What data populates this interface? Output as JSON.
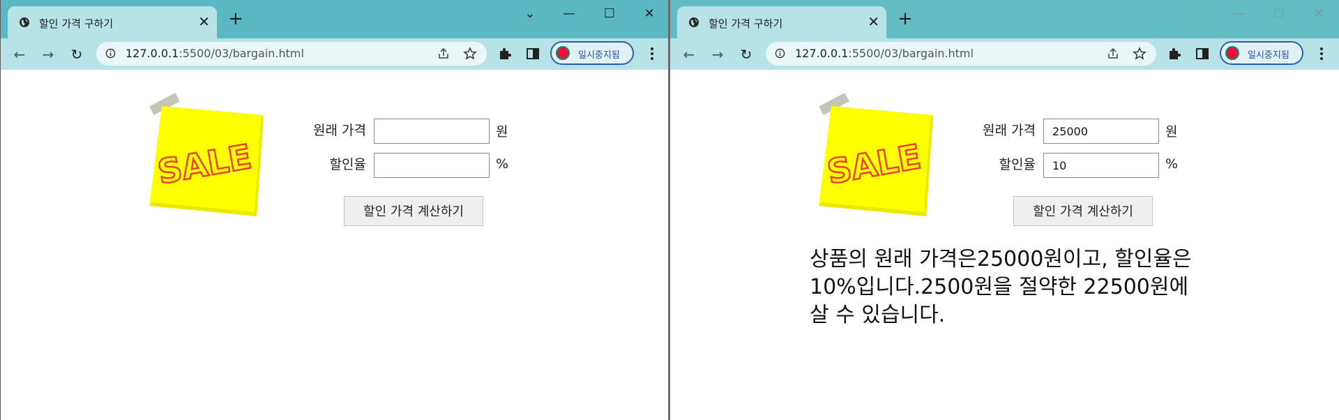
{
  "tab": {
    "title": "할인 가격 구하기",
    "close": "✕",
    "new_tab": "+"
  },
  "window_controls": {
    "dropdown": "⌄",
    "minimize": "—",
    "maximize": "☐",
    "close": "✕"
  },
  "address_bar": {
    "url_host": "127.0.0.1",
    "url_path": ":5500/03/bargain.html"
  },
  "profile": {
    "label": "일시중지됨"
  },
  "form": {
    "price_label": "원래 가격",
    "price_unit": "원",
    "rate_label": "할인율",
    "rate_unit": "%",
    "button_label": "할인 가격 계산하기"
  },
  "left_window": {
    "price_value": "",
    "rate_value": ""
  },
  "right_window": {
    "price_value": "25000",
    "rate_value": "10",
    "result_text": "상품의 원래 가격은25000원이고, 할인율은 10%입니다.2500원을 절약한 22500원에 살 수 있습니다."
  },
  "sale_sticker": {
    "text": "SALE"
  },
  "colors": {
    "titlebar": "#5ab8c2",
    "toolbar": "#b7e3e7",
    "sticker": "#ffff00",
    "sale_text": "#e8402b"
  }
}
